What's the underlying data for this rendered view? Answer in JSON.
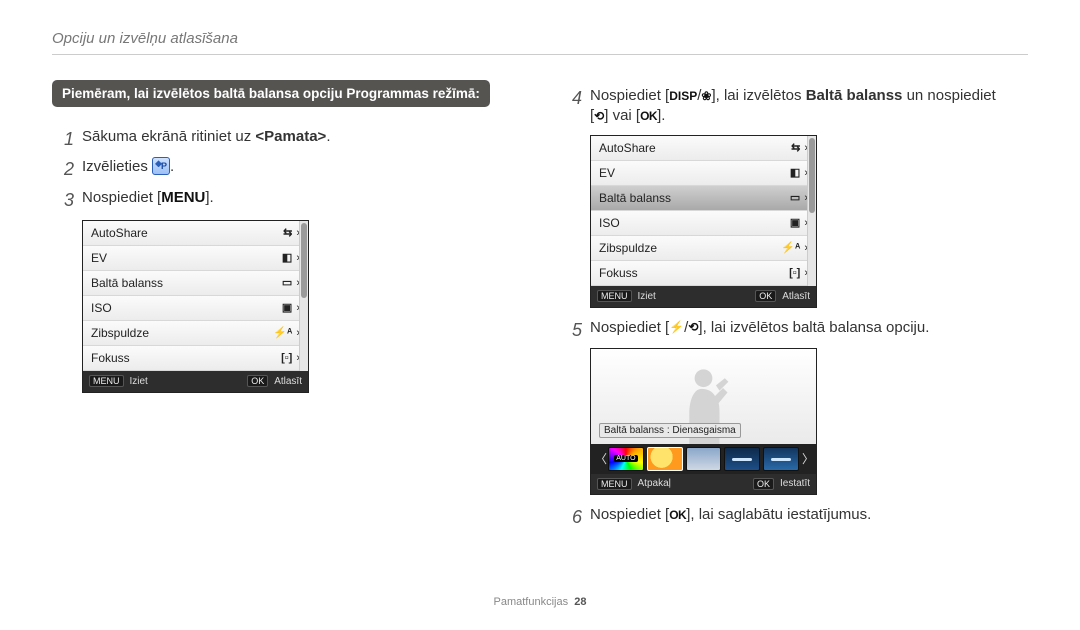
{
  "header": {
    "title": "Opciju un izvēlņu atlasīšana"
  },
  "footer": {
    "section": "Pamatfunkcijas",
    "page": "28"
  },
  "highlight": "Piemēram, lai izvēlētos baltā balansa opciju Programmas režīmā:",
  "steps": {
    "s1": {
      "num": "1",
      "a": "Sākuma ekrānā ritiniet uz ",
      "b": "<Pamata>",
      "c": "."
    },
    "s2": {
      "num": "2",
      "a": "Izvēlieties ",
      "c": "."
    },
    "s3": {
      "num": "3",
      "a": "Nospiediet [",
      "c": "]."
    },
    "s4": {
      "num": "4",
      "a": "Nospiediet [",
      "mid": "], lai izvēlētos ",
      "bold": "Baltā balanss",
      "tail": " un nospiediet",
      "line2a": "[",
      "line2b": "] vai [",
      "line2c": "]."
    },
    "s5": {
      "num": "5",
      "a": "Nospiediet [",
      "mid": "], lai izvēlētos baltā balansa opciju."
    },
    "s6": {
      "num": "6",
      "a": "Nospiediet [",
      "c": "], lai saglabātu iestatījumus."
    }
  },
  "icons": {
    "menu": "MENU",
    "ok": "OK",
    "disp": "DISP",
    "flower": "❀",
    "timer": "⟲",
    "flash": "⚡"
  },
  "menuPanel": {
    "items": [
      {
        "label": "AutoShare",
        "glyph": "⇆"
      },
      {
        "label": "EV",
        "glyph": "◧"
      },
      {
        "label": "Baltā balanss",
        "glyph": "▭"
      },
      {
        "label": "ISO",
        "glyph": "▣"
      },
      {
        "label": "Zibspuldze",
        "glyph": "⚡ᴬ"
      },
      {
        "label": "Fokuss",
        "glyph": "[▫]"
      }
    ],
    "footer": {
      "menuTag": "MENU",
      "exit": "Iziet",
      "okTag": "OK",
      "select": "Atlasīt"
    }
  },
  "wbPreview": {
    "tooltip": "Baltā balanss : Dienasgaisma",
    "footer": {
      "menuTag": "MENU",
      "back": "Atpakaļ",
      "okTag": "OK",
      "set": "Iestatīt"
    }
  }
}
